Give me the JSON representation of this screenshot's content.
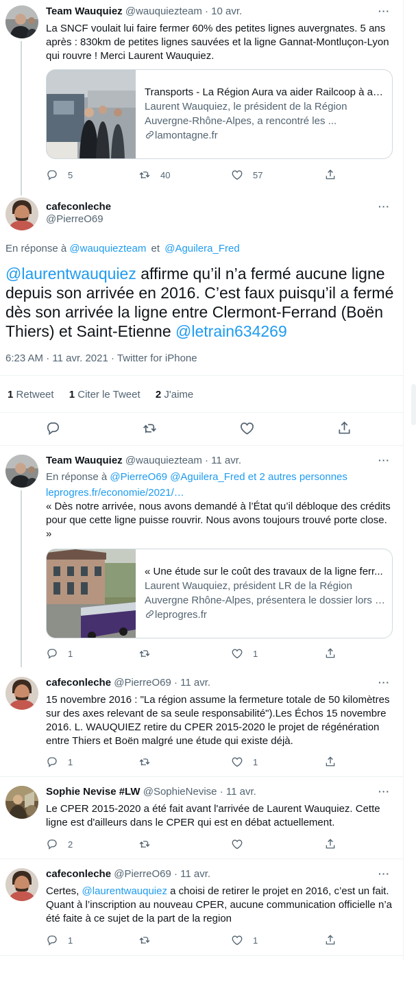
{
  "tweets": {
    "t1": {
      "name": "Team Wauquiez",
      "handle": "@wauquiezteam",
      "time": "10 avr.",
      "text": "La SNCF voulait lui faire fermer 60% des petites lignes auvergnates. 5 ans après : 830km de petites lignes sauvées et la ligne Gannat-Montluçon-Lyon qui rouvre ! Merci Laurent Wauquiez.",
      "card": {
        "title": "Transports - La Région Aura va aider Railcoop à ac...",
        "desc1": "Laurent Wauquiez, le président de la Région",
        "desc2": "Auvergne-Rhône-Alpes, a rencontré les ...",
        "domain": "lamontagne.fr"
      },
      "replies": "5",
      "retweets": "40",
      "likes": "57"
    },
    "main": {
      "name": "cafeconleche",
      "handle": "@PierreO69",
      "reply_prefix": "En réponse à",
      "reply_to_1": "@wauquiezteam",
      "reply_and": "et",
      "reply_to_2": "@Aguilera_Fred",
      "mention_1": "@laurentwauquiez",
      "text_1": " affirme qu’il n’a fermé aucune ligne depuis son arrivée en 2016. C’est faux puisqu’il a fermé dès son arrivée  la ligne entre Clermont-Ferrand (Boën Thiers) et Saint-Etienne ",
      "mention_2": "@letrain634269",
      "meta": "6:23 AM · 11 avr. 2021 · Twitter for iPhone",
      "retweets_count": "1",
      "retweets_label": "Retweet",
      "quotes_count": "1",
      "quotes_label": "Citer le Tweet",
      "likes_count": "2",
      "likes_label": "J'aime"
    },
    "t3": {
      "name": "Team Wauquiez",
      "handle": "@wauquiezteam",
      "time": "11 avr.",
      "reply_prefix": "En réponse à",
      "reply_to": "@PierreO69 @Aguilera_Fred",
      "reply_and": "et 2 autres personnes",
      "link": "leprogres.fr/economie/2021/…",
      "text": "« Dès notre arrivée, nous avons demandé à l’État qu’il débloque des crédits pour que cette ligne puisse rouvrir. Nous avons toujours trouvé porte close. »",
      "card": {
        "title": "« Une étude sur le coût des travaux de la ligne ferr...",
        "desc1": "Laurent Wauquiez, président LR de la Région",
        "desc2": "Auvergne Rhône-Alpes, présentera le dossier lors d...",
        "domain": "leprogres.fr"
      },
      "replies": "1",
      "retweets": "",
      "likes": "1"
    },
    "t4": {
      "name": "cafeconleche",
      "handle": "@PierreO69",
      "time": "11 avr.",
      "text": "15 novembre 2016 : \"La région assume la fermeture totale de 50 kilomètres sur des axes relevant de sa seule responsabilité\").Les Échos 15 novembre 2016. L. WAUQUIEZ retire du CPER 2015-2020 le projet de régénération entre Thiers et Boën malgré une étude qui existe déjà.",
      "replies": "1",
      "retweets": "",
      "likes": "1"
    },
    "t5": {
      "name": "Sophie Nevise #LW",
      "handle": "@SophieNevise",
      "time": "11 avr.",
      "text": "Le CPER 2015-2020 a été fait avant l'arrivée de Laurent Wauquiez. Cette ligne est d'ailleurs dans le CPER qui est en débat actuellement.",
      "replies": "2",
      "retweets": "",
      "likes": ""
    },
    "t6": {
      "name": "cafeconleche",
      "handle": "@PierreO69",
      "time": "11 avr.",
      "text_pre": "Certes, ",
      "mention": "@laurentwauquiez",
      "text_post": " a choisi de retirer le projet en 2016, c’est un fait. Quant à l’inscription au nouveau CPER, aucune communication officielle n’a été faite à ce sujet de la part de la region",
      "replies": "1",
      "retweets": "",
      "likes": "1"
    }
  },
  "ui": {
    "separator": " · ",
    "more_glyph": "···"
  },
  "colors": {
    "link": "#1d9bf0",
    "muted": "#536471",
    "border": "#cfd9de"
  },
  "icons": [
    "reply-icon",
    "retweet-icon",
    "like-icon",
    "share-icon",
    "link-icon",
    "more-icon"
  ]
}
